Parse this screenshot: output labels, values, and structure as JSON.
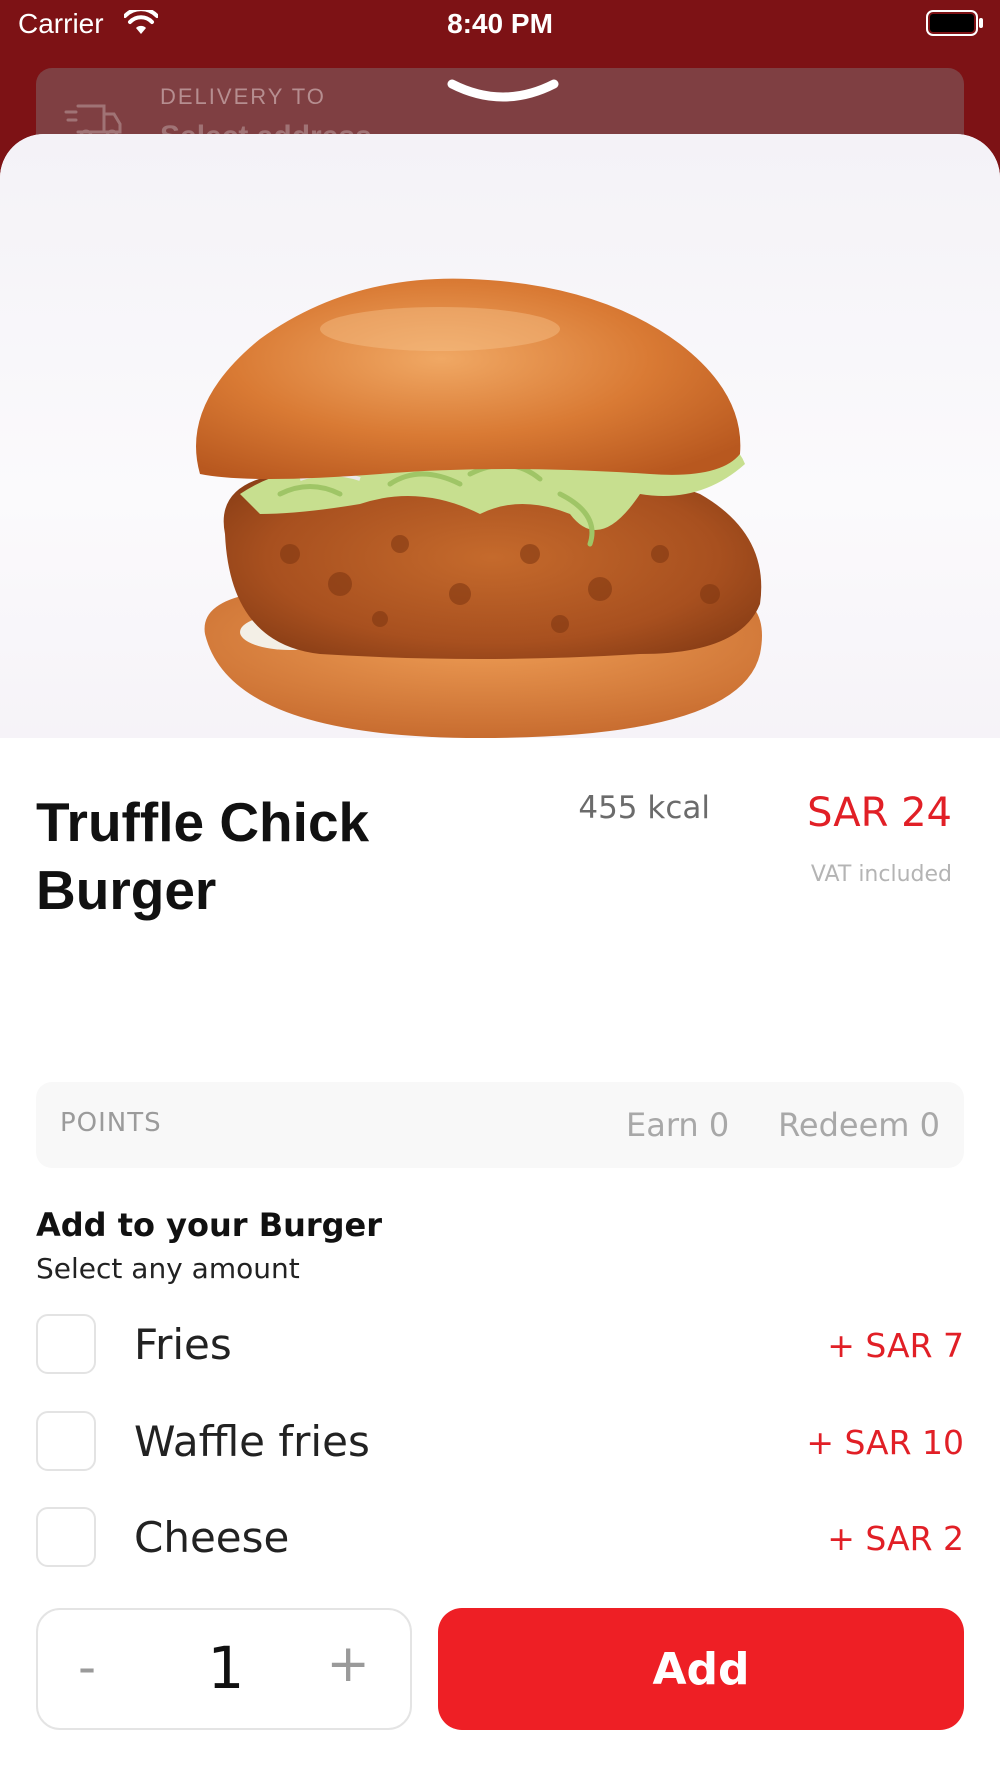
{
  "status_bar": {
    "carrier": "Carrier",
    "time": "8:40 PM"
  },
  "delivery": {
    "label": "DELIVERY TO",
    "value": "Select address",
    "icon": "truck-icon"
  },
  "product": {
    "name": "Truffle Chick Burger",
    "calories": "455 kcal",
    "price": "SAR 24",
    "vat_note": "VAT included"
  },
  "points": {
    "label": "POINTS",
    "earn": "Earn 0",
    "redeem": "Redeem 0"
  },
  "addons": {
    "title": "Add to your Burger",
    "subtitle": "Select any amount",
    "options": [
      {
        "label": "Fries",
        "price": "+  SAR 7",
        "checked": false
      },
      {
        "label": "Waffle fries",
        "price": "+  SAR 10",
        "checked": false
      },
      {
        "label": "Cheese",
        "price": "+  SAR 2",
        "checked": false
      }
    ]
  },
  "quantity": {
    "minus": "-",
    "value": "1",
    "plus": "+"
  },
  "add_button": "Add",
  "colors": {
    "brand_red": "#ee1f25",
    "header_bg": "#7d1215"
  }
}
